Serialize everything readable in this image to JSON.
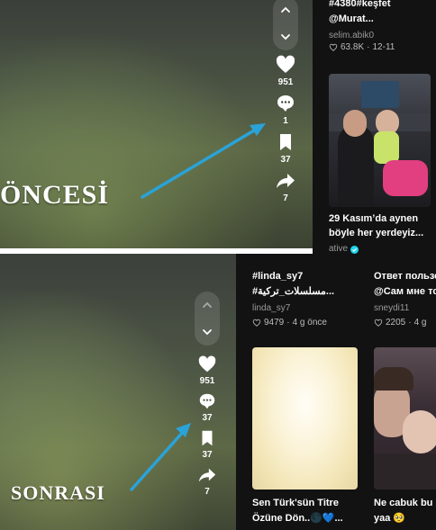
{
  "before": {
    "label": "ÖNCESİ",
    "actions": {
      "likes": "951",
      "comments": "1",
      "saves": "37",
      "shares": "7"
    },
    "grid": {
      "card1": {
        "caption_line1": "#4380#keşfet",
        "caption_line2": "@Murat...",
        "author": "selim.abik0",
        "likes": "63.8K",
        "date": "12-11"
      },
      "card2": {
        "caption_line1": "29 Kasım’da aynen",
        "caption_line2": "böyle her yerdeyiz...",
        "author": "ative"
      }
    }
  },
  "after": {
    "label": "SONRASI",
    "actions": {
      "likes": "951",
      "comments": "37",
      "saves": "37",
      "shares": "7"
    },
    "grid": {
      "col1_top": {
        "caption_line1": "#linda_sy7",
        "caption_line2": "#مسلسلات_تركية...",
        "author": "linda_sy7",
        "likes": "9479",
        "date": "4 g önce"
      },
      "col2_top": {
        "caption_line1": "Ответ пользо",
        "caption_line2": "@Сам мне то",
        "author": "sneydi11",
        "likes": "2205",
        "date": "4 g"
      },
      "col1_bottom": {
        "caption_line1": "Sen Türk'sün Titre",
        "caption_line2": "Özüne Dön..🌑💙..."
      },
      "col2_bottom": {
        "caption_line1": "Ne cabuk bu",
        "caption_line2": "yaa 🥺"
      }
    }
  },
  "colors": {
    "arrow": "#2aa3d8",
    "grid_bg": "#121212",
    "verified": "#20d5ec"
  }
}
